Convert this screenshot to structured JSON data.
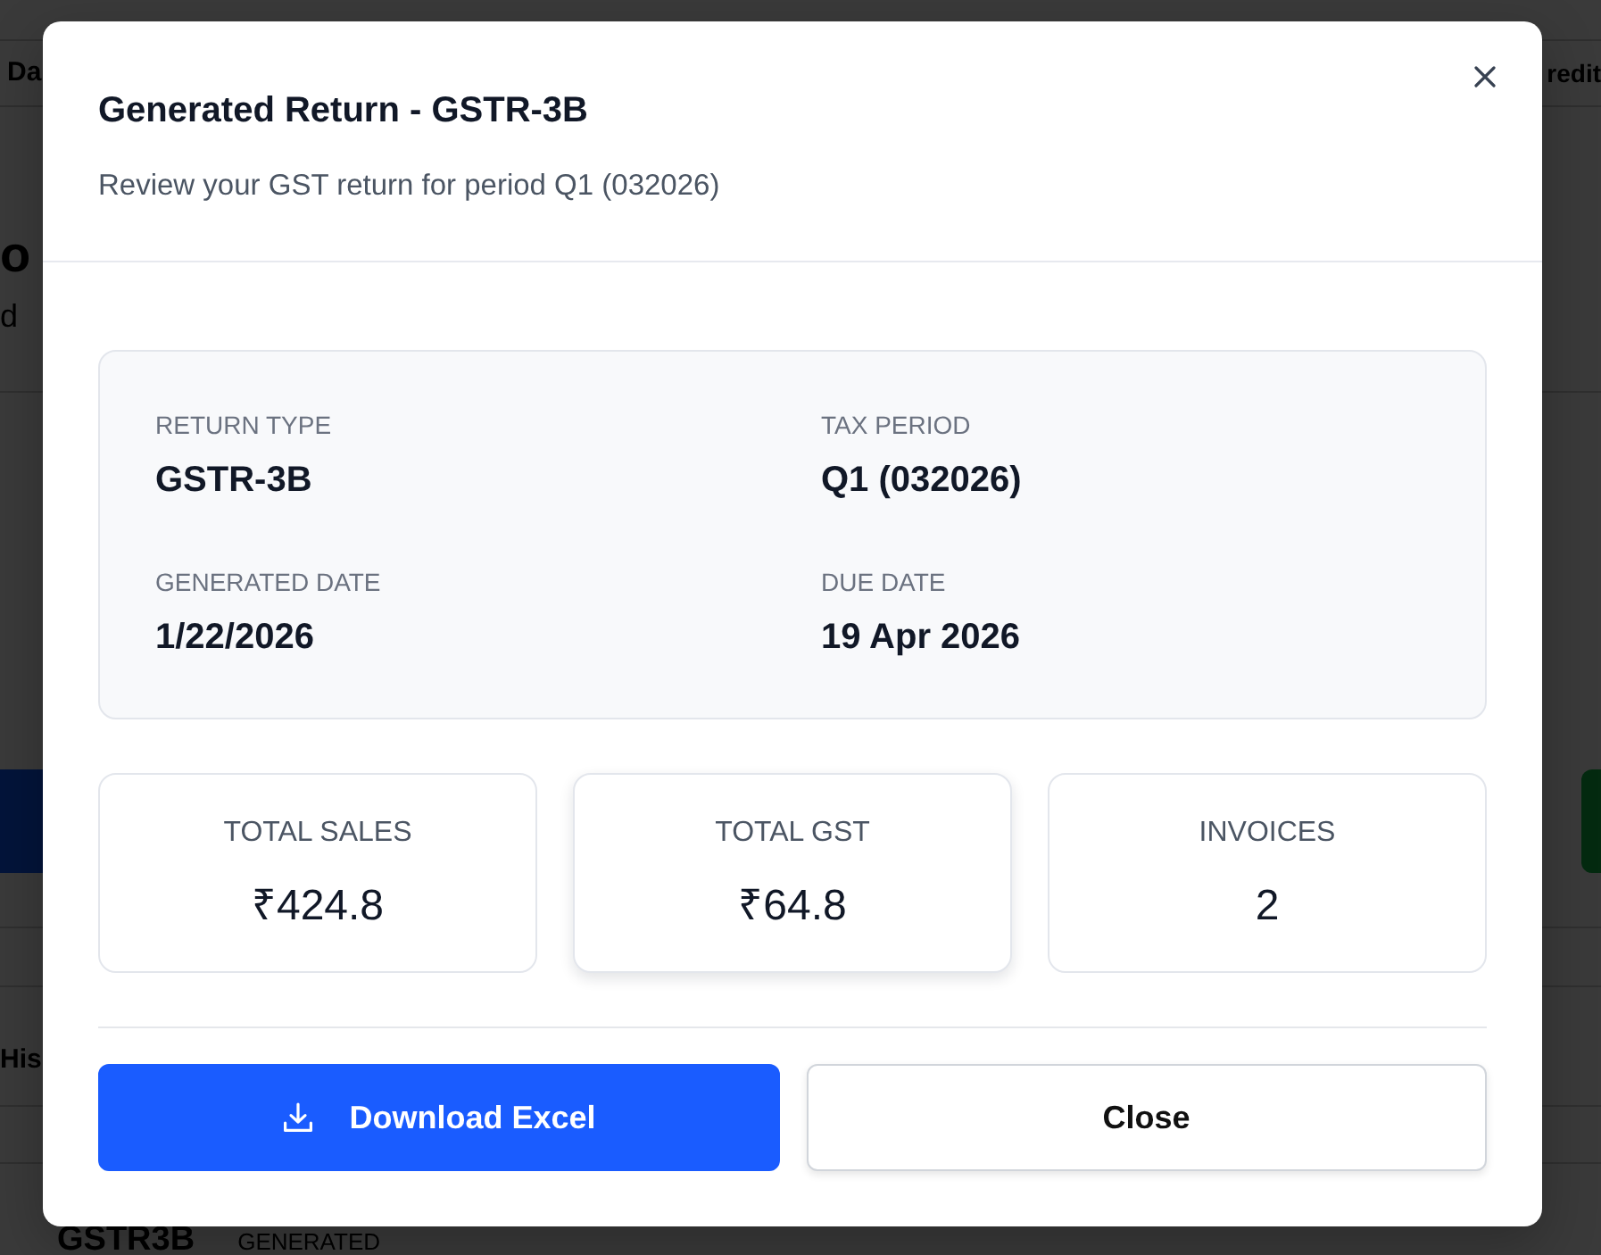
{
  "background": {
    "tab_left": "Da",
    "tab_right": "redit",
    "heading": "o",
    "subheading": "d",
    "action_left": {
      "kind": "primary"
    },
    "action_right": {
      "kind": "success"
    },
    "section_heading": "His",
    "row": {
      "column_1": "GSTR3B",
      "column_2": "GENERATED"
    }
  },
  "modal": {
    "title": "Generated Return - GSTR-3B",
    "subtitle": "Review your GST return for period Q1 (032026)",
    "details": [
      {
        "label": "RETURN TYPE",
        "value": "GSTR-3B"
      },
      {
        "label": "TAX PERIOD",
        "value": "Q1 (032026)"
      },
      {
        "label": "GENERATED DATE",
        "value": "1/22/2026"
      },
      {
        "label": "DUE DATE",
        "value": "19 Apr 2026"
      }
    ],
    "stats": [
      {
        "label": "TOTAL SALES",
        "value": "₹424.8",
        "hovered": false
      },
      {
        "label": "TOTAL GST",
        "value": "₹64.8",
        "hovered": true
      },
      {
        "label": "INVOICES",
        "value": "2",
        "hovered": false
      }
    ],
    "buttons": [
      {
        "kind": "primary",
        "label": "Download Excel"
      },
      {
        "kind": "secondary",
        "label": "Close"
      }
    ]
  }
}
